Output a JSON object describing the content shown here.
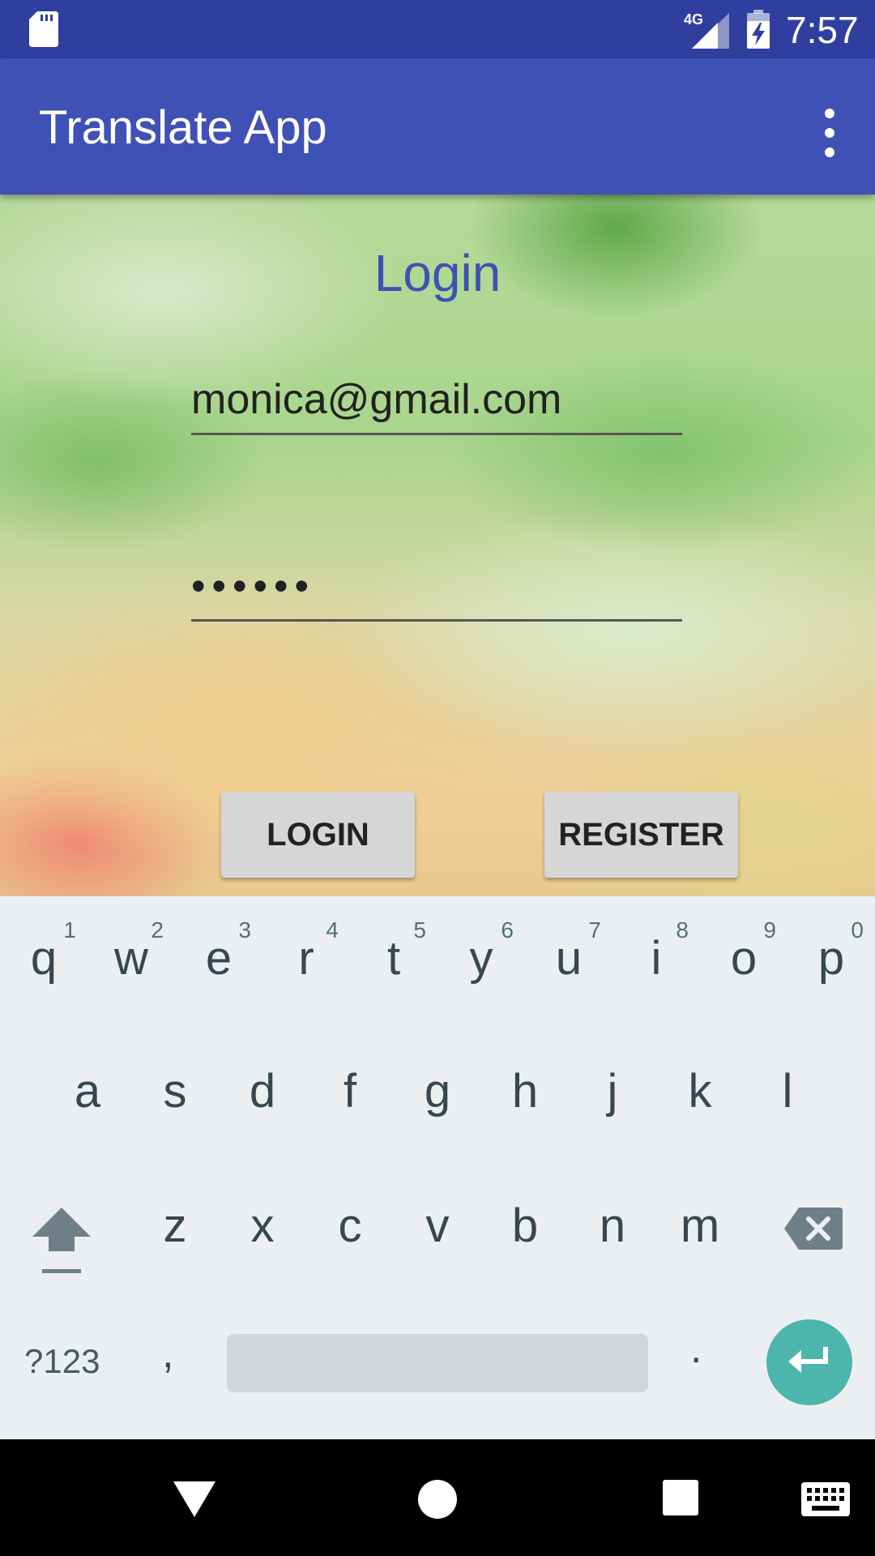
{
  "status_bar": {
    "network": "4G",
    "time": "7:57",
    "icons": [
      "sd-card-icon",
      "signal-icon",
      "battery-charging-icon"
    ]
  },
  "app_bar": {
    "title": "Translate App",
    "menu_icon": "overflow-menu-icon"
  },
  "login": {
    "title": "Login",
    "email_value": "monica@gmail.com",
    "password_value": "••••••",
    "login_button": "LOGIN",
    "register_button": "REGISTER"
  },
  "keyboard": {
    "row1": [
      {
        "ch": "q",
        "num": "1"
      },
      {
        "ch": "w",
        "num": "2"
      },
      {
        "ch": "e",
        "num": "3"
      },
      {
        "ch": "r",
        "num": "4"
      },
      {
        "ch": "t",
        "num": "5"
      },
      {
        "ch": "y",
        "num": "6"
      },
      {
        "ch": "u",
        "num": "7"
      },
      {
        "ch": "i",
        "num": "8"
      },
      {
        "ch": "o",
        "num": "9"
      },
      {
        "ch": "p",
        "num": "0"
      }
    ],
    "row2": [
      "a",
      "s",
      "d",
      "f",
      "g",
      "h",
      "j",
      "k",
      "l"
    ],
    "row3": [
      "z",
      "x",
      "c",
      "v",
      "b",
      "n",
      "m"
    ],
    "symbols_key": "?123",
    "comma_key": ",",
    "period_key": ".",
    "enter_icon": "enter-arrow-icon",
    "shift_icon": "shift-icon",
    "backspace_icon": "backspace-icon"
  },
  "nav_bar": {
    "icons": [
      "back-icon",
      "home-icon",
      "recents-icon",
      "keyboard-switch-icon"
    ]
  },
  "colors": {
    "status_bar": "#303F9F",
    "app_bar": "#3F51B5",
    "accent": "#4DB6AC",
    "keyboard_bg": "#ECEFF1"
  }
}
